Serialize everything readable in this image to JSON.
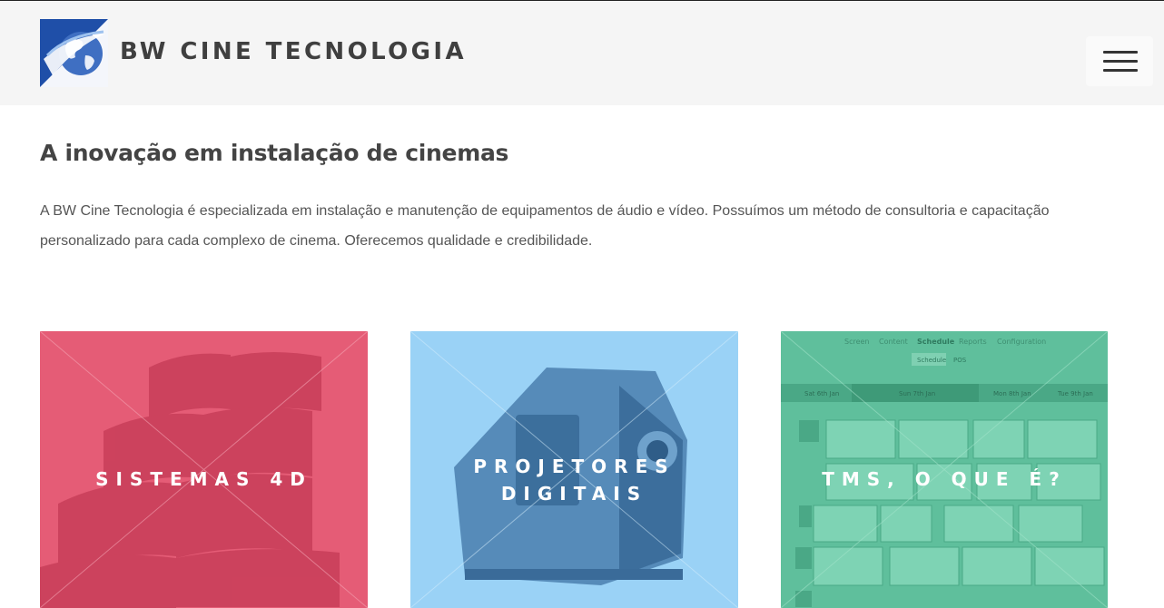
{
  "header": {
    "site_title": "BW CINE TECNOLOGIA",
    "logo_icon": "globe-logo-icon",
    "menu_icon": "hamburger-menu-icon"
  },
  "main": {
    "heading": "A inovação em instalação de cinemas",
    "intro": "A BW Cine Tecnologia é especializada em instalação e manutenção de equipamentos de áudio e vídeo. Possuímos um método de consultoria e capacitação personalizado para cada complexo de cinema. Oferecemos qualidade e credibilidade."
  },
  "cards": [
    {
      "label": "SISTEMAS 4D",
      "overlay_color": "#e85a78"
    },
    {
      "label_line1": "PROJETORES",
      "label_line2": "DIGITAIS",
      "overlay_color": "#8ecdf2"
    },
    {
      "label": "TMS, O QUE É?",
      "overlay_color": "#5cbf9d"
    }
  ],
  "tms_screen": {
    "tabs": [
      "Screen",
      "Content",
      "Schedule",
      "Reports",
      "Configuration"
    ],
    "subtabs": [
      "Schedule",
      "POS"
    ],
    "days": [
      "Sat 6th Jan",
      "Sun 7th Jan",
      "Mon 8th Jan",
      "Tue 9th Jan"
    ]
  }
}
